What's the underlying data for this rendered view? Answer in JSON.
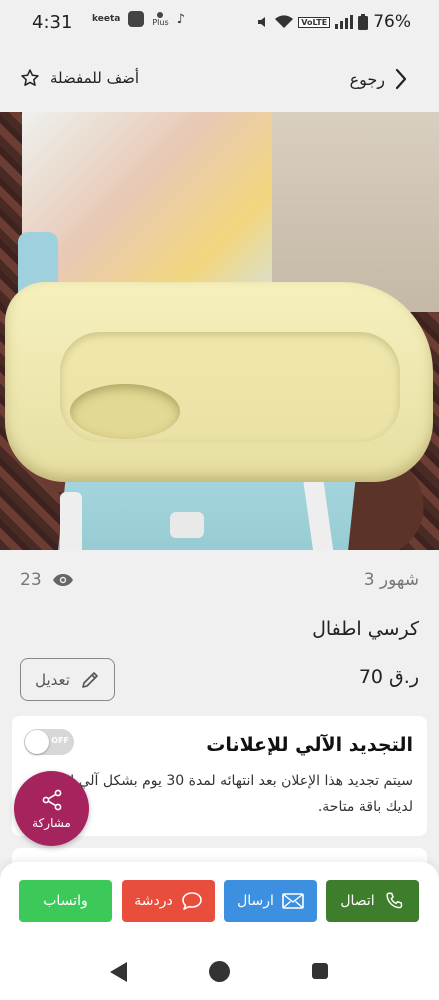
{
  "status_bar": {
    "time": "4:31",
    "app_text": "keeta",
    "plus_text": "Plus",
    "network_badge": "VoLTE",
    "battery": "76%"
  },
  "header": {
    "back_label": "رجوع",
    "favorite_label": "أضف للمفضلة"
  },
  "listing": {
    "views": "23",
    "posted_ago": "3 شهور",
    "title": "كرسي اطفال",
    "price": "70 ر.ق",
    "edit_label": "تعديل",
    "image_count": 2,
    "active_image_index": 1
  },
  "auto_renew": {
    "title": "التجديد الآلي للإعلانات",
    "toggle_state": "OFF",
    "description": "سيتم تجديد هذا الإعلان بعد انتهائه لمدة 30 يوم بشكل آلي إذا كان لديك باقة متاحة."
  },
  "share": {
    "label": "مشاركة"
  },
  "actions": {
    "call": "اتصال",
    "send": "ارسال",
    "chat": "دردشة",
    "whatsapp": "واتساب"
  },
  "colors": {
    "share_fab": "#a6245e",
    "call": "#3e7d2b",
    "send": "#3d8fe0",
    "chat": "#e84e3b",
    "whatsapp": "#3dc85a"
  }
}
